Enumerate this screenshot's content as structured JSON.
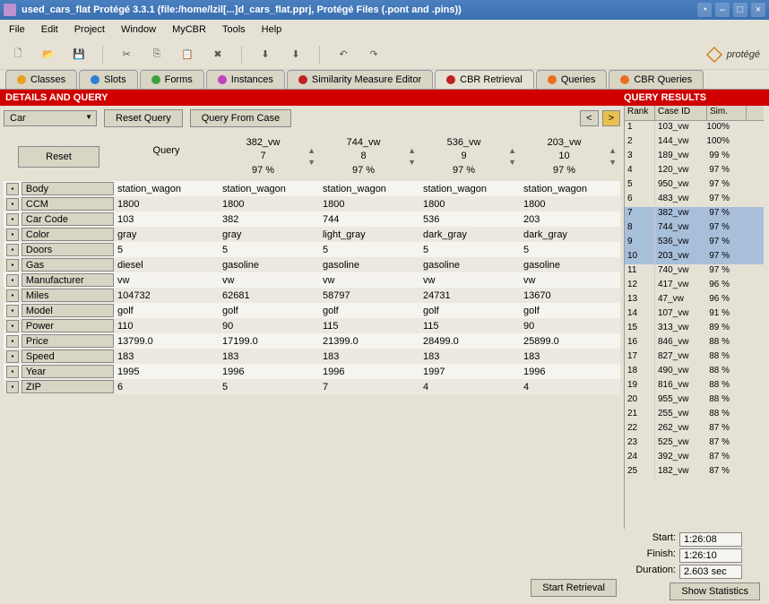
{
  "titlebar": {
    "title": "used_cars_flat  Protégé 3.3.1    (file:/home/lzil[...]d_cars_flat.pprj, Protégé Files (.pont and .pins))"
  },
  "menubar": [
    "File",
    "Edit",
    "Project",
    "Window",
    "MyCBR",
    "Tools",
    "Help"
  ],
  "tabs": [
    {
      "label": "Classes",
      "color": "#e8a020"
    },
    {
      "label": "Slots",
      "color": "#3080d0"
    },
    {
      "label": "Forms",
      "color": "#40a040"
    },
    {
      "label": "Instances",
      "color": "#c040c0"
    },
    {
      "label": "Similarity Measure Editor",
      "color": "#c02020"
    },
    {
      "label": "CBR Retrieval",
      "color": "#c02020",
      "active": true
    },
    {
      "label": "Queries",
      "color": "#e87020"
    },
    {
      "label": "CBR Queries",
      "color": "#e87020"
    }
  ],
  "headers": {
    "left": "DETAILS AND QUERY",
    "right": "QUERY RESULTS"
  },
  "controls": {
    "combo": "Car",
    "reset_query": "Reset Query",
    "query_from_case": "Query From Case",
    "prev": "<",
    "next": ">",
    "reset": "Reset",
    "query_head": "Query",
    "start_retrieval": "Start Retrieval",
    "show_stats": "Show Statistics"
  },
  "case_heads": [
    {
      "id": "382_vw",
      "rank": "7",
      "pct": "97 %"
    },
    {
      "id": "744_vw",
      "rank": "8",
      "pct": "97 %"
    },
    {
      "id": "536_vw",
      "rank": "9",
      "pct": "97 %"
    },
    {
      "id": "203_vw",
      "rank": "10",
      "pct": "97 %"
    }
  ],
  "attrs": [
    "Body",
    "CCM",
    "Car Code",
    "Color",
    "Doors",
    "Gas",
    "Manufacturer",
    "Miles",
    "Model",
    "Power",
    "Price",
    "Speed",
    "Year",
    "ZIP"
  ],
  "rows": [
    [
      "station_wagon",
      "station_wagon",
      "station_wagon",
      "station_wagon",
      "station_wagon"
    ],
    [
      "1800",
      "1800",
      "1800",
      "1800",
      "1800"
    ],
    [
      "103",
      "382",
      "744",
      "536",
      "203"
    ],
    [
      "gray",
      "gray",
      "light_gray",
      "dark_gray",
      "dark_gray"
    ],
    [
      "5",
      "5",
      "5",
      "5",
      "5"
    ],
    [
      "diesel",
      "gasoline",
      "gasoline",
      "gasoline",
      "gasoline"
    ],
    [
      "vw",
      "vw",
      "vw",
      "vw",
      "vw"
    ],
    [
      "104732",
      "62681",
      "58797",
      "24731",
      "13670"
    ],
    [
      "golf",
      "golf",
      "golf",
      "golf",
      "golf"
    ],
    [
      "110",
      "90",
      "115",
      "115",
      "90"
    ],
    [
      "13799.0",
      "17199.0",
      "21399.0",
      "28499.0",
      "25899.0"
    ],
    [
      "183",
      "183",
      "183",
      "183",
      "183"
    ],
    [
      "1995",
      "1996",
      "1996",
      "1997",
      "1996"
    ],
    [
      "6",
      "5",
      "7",
      "4",
      "4"
    ]
  ],
  "results_head": {
    "rank": "Rank",
    "cid": "Case ID",
    "sim": "Sim."
  },
  "results": [
    {
      "rank": "1",
      "cid": "103_vw",
      "sim": "100%"
    },
    {
      "rank": "2",
      "cid": "144_vw",
      "sim": "100%"
    },
    {
      "rank": "3",
      "cid": "189_vw",
      "sim": "99 %"
    },
    {
      "rank": "4",
      "cid": "120_vw",
      "sim": "97 %"
    },
    {
      "rank": "5",
      "cid": "950_vw",
      "sim": "97 %"
    },
    {
      "rank": "6",
      "cid": "483_vw",
      "sim": "97 %"
    },
    {
      "rank": "7",
      "cid": "382_vw",
      "sim": "97 %",
      "hl": true
    },
    {
      "rank": "8",
      "cid": "744_vw",
      "sim": "97 %",
      "hl": true
    },
    {
      "rank": "9",
      "cid": "536_vw",
      "sim": "97 %",
      "hl": true
    },
    {
      "rank": "10",
      "cid": "203_vw",
      "sim": "97 %",
      "hl": true
    },
    {
      "rank": "11",
      "cid": "740_vw",
      "sim": "97 %"
    },
    {
      "rank": "12",
      "cid": "417_vw",
      "sim": "96 %"
    },
    {
      "rank": "13",
      "cid": "47_vw",
      "sim": "96 %"
    },
    {
      "rank": "14",
      "cid": "107_vw",
      "sim": "91 %"
    },
    {
      "rank": "15",
      "cid": "313_vw",
      "sim": "89 %"
    },
    {
      "rank": "16",
      "cid": "846_vw",
      "sim": "88 %"
    },
    {
      "rank": "17",
      "cid": "827_vw",
      "sim": "88 %"
    },
    {
      "rank": "18",
      "cid": "490_vw",
      "sim": "88 %"
    },
    {
      "rank": "19",
      "cid": "816_vw",
      "sim": "88 %"
    },
    {
      "rank": "20",
      "cid": "955_vw",
      "sim": "88 %"
    },
    {
      "rank": "21",
      "cid": "255_vw",
      "sim": "88 %"
    },
    {
      "rank": "22",
      "cid": "262_vw",
      "sim": "87 %"
    },
    {
      "rank": "23",
      "cid": "525_vw",
      "sim": "87 %"
    },
    {
      "rank": "24",
      "cid": "392_vw",
      "sim": "87 %"
    },
    {
      "rank": "25",
      "cid": "182_vw",
      "sim": "87 %"
    }
  ],
  "timing": {
    "start_lbl": "Start:",
    "start_val": "1:26:08",
    "finish_lbl": "Finish:",
    "finish_val": "1:26:10",
    "duration_lbl": "Duration:",
    "duration_val": "2.603 sec"
  },
  "logo": "protégé"
}
